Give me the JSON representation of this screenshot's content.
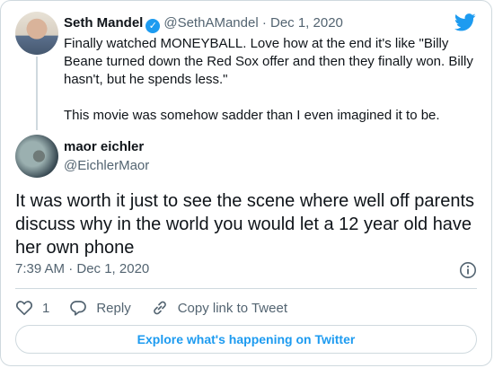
{
  "parent_tweet": {
    "author_name": "Seth Mandel",
    "handle": "@SethAMandel",
    "separator": "·",
    "date": "Dec 1, 2020",
    "text_line_1": "Finally watched MONEYBALL. Love how at the end it's like \"Billy Beane turned down the Red Sox offer and then they finally won. Billy hasn't, but he spends less.\"",
    "text_line_2": "This movie was somehow sadder than I even imagined it to be."
  },
  "tweet": {
    "author_name": "maor eichler",
    "handle": "@EichlerMaor",
    "text": "It was worth it just to see the scene where well off parents discuss why in the world you would let a 12 year old have her own phone",
    "timestamp": "7:39 AM · Dec 1, 2020"
  },
  "actions": {
    "like_count": "1",
    "reply_label": "Reply",
    "copy_link_label": "Copy link to Tweet"
  },
  "explore_label": "Explore what's happening on Twitter",
  "colors": {
    "accent": "#1d9bf0",
    "text": "#0f1419",
    "muted": "#536471",
    "border": "#cfd9de"
  },
  "icons": {
    "brand": "twitter-bird-icon",
    "verified": "verified-badge-icon",
    "info": "info-icon",
    "like": "heart-icon",
    "reply": "reply-icon",
    "copy_link": "link-icon"
  }
}
